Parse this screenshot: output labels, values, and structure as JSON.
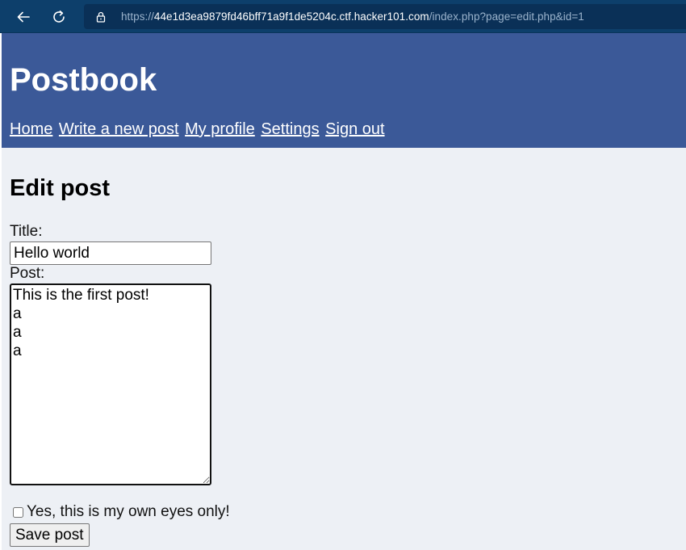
{
  "browser": {
    "url_prefix": "https://",
    "url_host": "44e1d3ea9879fd46bff71a9f1de5204c.ctf.hacker101.com",
    "url_path": "/index.php?page=edit.php&id=1",
    "icons": {
      "back": "arrow-left-icon",
      "reload": "reload-icon",
      "lock": "lock-icon"
    },
    "colors": {
      "toolbar": "#0d3f6b",
      "address_bar": "#0a3057"
    }
  },
  "header": {
    "site_title": "Postbook",
    "nav": [
      {
        "label": "Home"
      },
      {
        "label": "Write a new post"
      },
      {
        "label": "My profile"
      },
      {
        "label": "Settings"
      },
      {
        "label": "Sign out"
      }
    ],
    "background_color": "#3b5998"
  },
  "main": {
    "heading": "Edit post",
    "title_label": "Title:",
    "title_value": "Hello world",
    "post_label": "Post:",
    "post_value": "This is the first post!\na\na\na",
    "privacy_label": "Yes, this is my own eyes only!",
    "privacy_checked": false,
    "save_label": "Save post"
  }
}
